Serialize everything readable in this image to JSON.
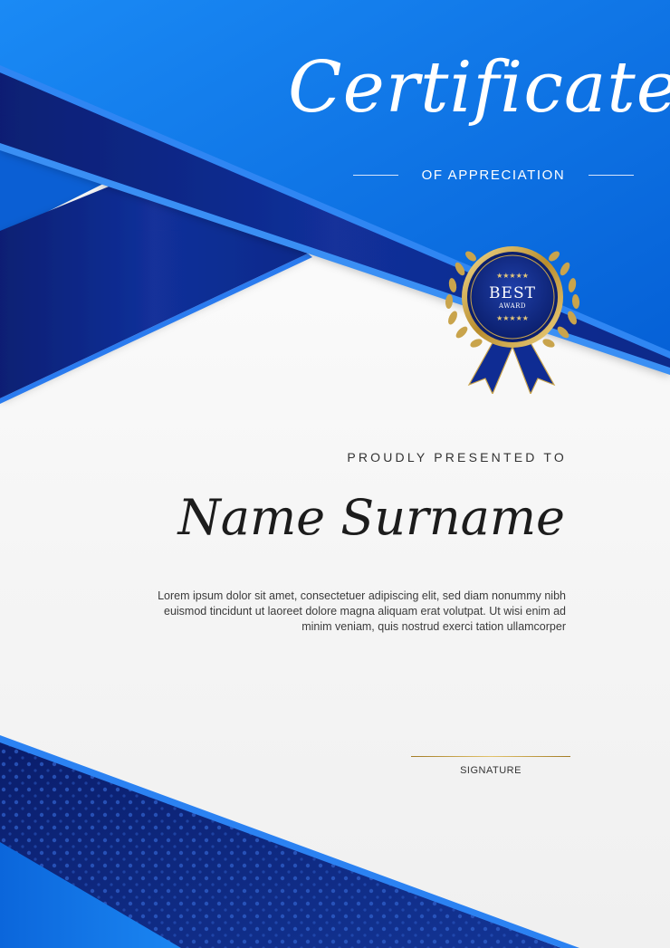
{
  "certificate": {
    "title": "Certificate",
    "subtitle": "OF APPRECIATION",
    "presented_label": "PROUDLY PRESENTED TO",
    "recipient_name": "Name Surname",
    "body_line_1": "Lorem ipsum dolor sit amet, consectetuer adipiscing elit, sed diam nonummy nibh",
    "body_line_2": "euismod tincidunt ut laoreet dolore magna aliquam erat volutpat. Ut wisi enim ad",
    "body_line_3": "minim veniam, quis nostrud exerci tation ullamcorper",
    "signature_label": "SIGNATURE"
  },
  "badge": {
    "line_1": "BEST",
    "line_2": "AWARD",
    "stars_top": "★★★★★",
    "stars_bottom": "★★★★★",
    "icon": "award-ribbon-icon"
  },
  "colors": {
    "primary_blue": "#0a6fe0",
    "navy": "#0c2a8c",
    "gold": "#c9a44c",
    "background": "#f5f5f5"
  }
}
